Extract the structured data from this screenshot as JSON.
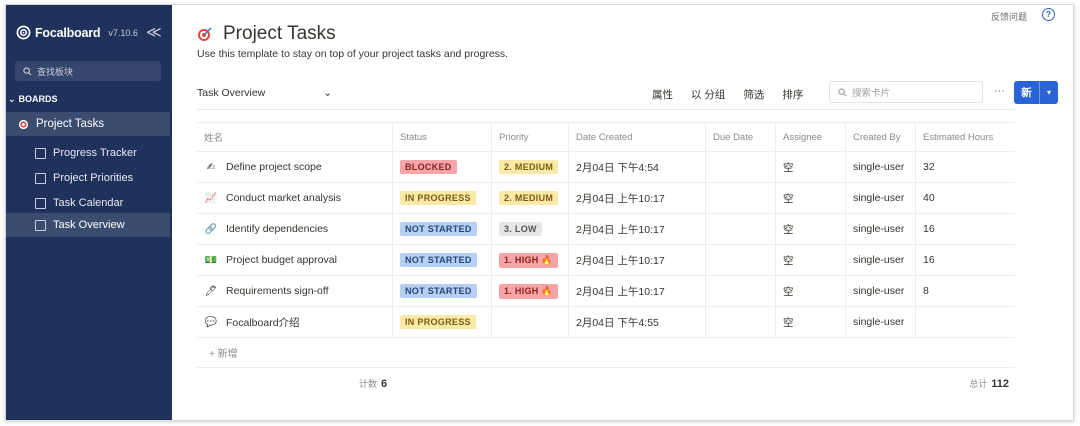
{
  "sidebar": {
    "brand": "Focalboard",
    "version": "v7.10.6",
    "collapse": "≪",
    "search_placeholder": "查找板块",
    "boards_heading": "BOARDS",
    "board_name": "Project Tasks",
    "views": [
      {
        "label": "Progress Tracker",
        "active": false
      },
      {
        "label": "Project Priorities",
        "active": false
      },
      {
        "label": "Task Calendar",
        "active": false
      },
      {
        "label": "Task Overview",
        "active": true
      }
    ]
  },
  "header": {
    "feedback": "反馈问题",
    "help": "?",
    "title": "Project Tasks",
    "subtitle": "Use this template to stay on top of your project tasks and progress."
  },
  "toolbar": {
    "view_name": "Task Overview",
    "properties": "属性",
    "group_by": "以 分组",
    "filter": "筛选",
    "sort": "排序",
    "search_placeholder": "搜索卡片",
    "more": "···",
    "new_label": "新"
  },
  "table": {
    "columns": [
      "姓名",
      "Status",
      "Priority",
      "Date Created",
      "Due Date",
      "Assignee",
      "Created By",
      "Estimated Hours"
    ],
    "rows": [
      {
        "icon": "✍",
        "name": "Define project scope",
        "status": "BLOCKED",
        "priority": "2. MEDIUM",
        "date": "2月04日 下午4:54",
        "due": "",
        "assignee": "空",
        "created_by": "single-user",
        "hours": "32"
      },
      {
        "icon": "📈",
        "name": "Conduct market analysis",
        "status": "IN PROGRESS",
        "priority": "2. MEDIUM",
        "date": "2月04日 上午10:17",
        "due": "",
        "assignee": "空",
        "created_by": "single-user",
        "hours": "40"
      },
      {
        "icon": "🔗",
        "name": "Identify dependencies",
        "status": "NOT STARTED",
        "priority": "3. LOW",
        "date": "2月04日 上午10:17",
        "due": "",
        "assignee": "空",
        "created_by": "single-user",
        "hours": "16"
      },
      {
        "icon": "💵",
        "name": "Project budget approval",
        "status": "NOT STARTED",
        "priority": "1. HIGH 🔥",
        "date": "2月04日 上午10:17",
        "due": "",
        "assignee": "空",
        "created_by": "single-user",
        "hours": "16"
      },
      {
        "icon": "🖊",
        "name": "Requirements sign-off",
        "status": "NOT STARTED",
        "priority": "1. HIGH 🔥",
        "date": "2月04日 上午10:17",
        "due": "",
        "assignee": "空",
        "created_by": "single-user",
        "hours": "8"
      },
      {
        "icon": "💬",
        "name": "Focalboard介绍",
        "status": "IN PROGRESS",
        "priority": "",
        "date": "2月04日 下午4:55",
        "due": "",
        "assignee": "空",
        "created_by": "single-user",
        "hours": ""
      }
    ],
    "add_row": "+ 新增"
  },
  "footer": {
    "count_label": "计数",
    "count_value": "6",
    "total_label": "总计",
    "total_value": "112"
  },
  "colors": {
    "sidebar_bg": "#1e325c",
    "accent": "#2a63d6",
    "blocked": "#f5a5a5",
    "in_progress": "#fbeaa7",
    "not_started": "#b7cff0"
  }
}
